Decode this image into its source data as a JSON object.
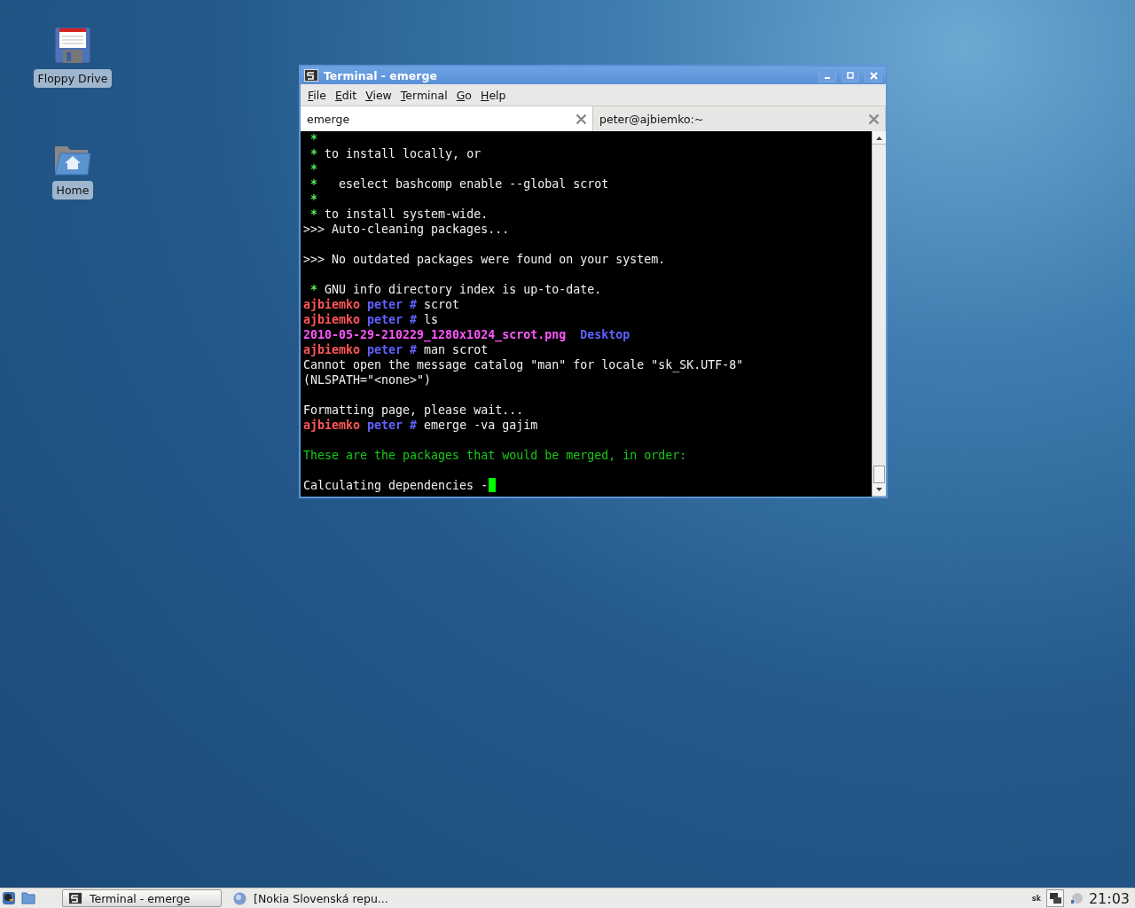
{
  "desktop_icons": [
    {
      "kind": "floppy",
      "label": "Floppy Drive"
    },
    {
      "kind": "home",
      "label": "Home"
    }
  ],
  "window": {
    "title": "Terminal - emerge",
    "active": true
  },
  "menu": [
    "File",
    "Edit",
    "View",
    "Terminal",
    "Go",
    "Help"
  ],
  "tabs": [
    {
      "label": "emerge",
      "selected": true
    },
    {
      "label": "peter@ajbiemko:~",
      "selected": false
    }
  ],
  "terminal": {
    "lines": [
      {
        "kind": "text",
        "segments": [
          {
            "kind": "star",
            "text": " *"
          }
        ]
      },
      {
        "kind": "text",
        "segments": [
          {
            "kind": "star",
            "text": " *"
          },
          {
            "kind": "plain",
            "text": " to install locally, or"
          }
        ]
      },
      {
        "kind": "text",
        "segments": [
          {
            "kind": "star",
            "text": " *"
          }
        ]
      },
      {
        "kind": "text",
        "segments": [
          {
            "kind": "star",
            "text": " *"
          },
          {
            "kind": "plain",
            "text": "   eselect bashcomp enable --global scrot"
          }
        ]
      },
      {
        "kind": "text",
        "segments": [
          {
            "kind": "star",
            "text": " *"
          }
        ]
      },
      {
        "kind": "text",
        "segments": [
          {
            "kind": "star",
            "text": " *"
          },
          {
            "kind": "plain",
            "text": " to install system-wide."
          }
        ]
      },
      {
        "kind": "text",
        "segments": [
          {
            "kind": "plain",
            "text": ">>> Auto-cleaning packages..."
          }
        ]
      },
      {
        "kind": "blank"
      },
      {
        "kind": "text",
        "segments": [
          {
            "kind": "plain",
            "text": ">>> No outdated packages were found on your system."
          }
        ]
      },
      {
        "kind": "blank"
      },
      {
        "kind": "text",
        "segments": [
          {
            "kind": "star",
            "text": " *"
          },
          {
            "kind": "plain",
            "text": " GNU info directory index is up-to-date."
          }
        ]
      },
      {
        "kind": "text",
        "segments": [
          {
            "kind": "host",
            "text": "ajbiemko"
          },
          {
            "kind": "user",
            "text": " peter #"
          },
          {
            "kind": "plain",
            "text": " scrot"
          }
        ]
      },
      {
        "kind": "text",
        "segments": [
          {
            "kind": "host",
            "text": "ajbiemko"
          },
          {
            "kind": "user",
            "text": " peter #"
          },
          {
            "kind": "plain",
            "text": " ls"
          }
        ]
      },
      {
        "kind": "text",
        "segments": [
          {
            "kind": "file",
            "text": "2010-05-29-210229_1280x1024_scrot.png"
          },
          {
            "kind": "dir",
            "text": "  Desktop"
          }
        ]
      },
      {
        "kind": "text",
        "segments": [
          {
            "kind": "host",
            "text": "ajbiemko"
          },
          {
            "kind": "user",
            "text": " peter #"
          },
          {
            "kind": "plain",
            "text": " man scrot"
          }
        ]
      },
      {
        "kind": "text",
        "segments": [
          {
            "kind": "plain",
            "text": "Cannot open the message catalog \"man\" for locale \"sk_SK.UTF-8\""
          }
        ]
      },
      {
        "kind": "text",
        "segments": [
          {
            "kind": "plain",
            "text": "(NLSPATH=\"<none>\")"
          }
        ]
      },
      {
        "kind": "blank"
      },
      {
        "kind": "text",
        "segments": [
          {
            "kind": "plain",
            "text": "Formatting page, please wait..."
          }
        ]
      },
      {
        "kind": "text",
        "segments": [
          {
            "kind": "host",
            "text": "ajbiemko"
          },
          {
            "kind": "user",
            "text": " peter #"
          },
          {
            "kind": "plain",
            "text": " emerge -va gajim"
          }
        ]
      },
      {
        "kind": "blank"
      },
      {
        "kind": "text",
        "segments": [
          {
            "kind": "notice",
            "text": "These are the packages that would be merged, in order:"
          }
        ]
      },
      {
        "kind": "blank"
      },
      {
        "kind": "text",
        "segments": [
          {
            "kind": "plain",
            "text": "Calculating dependencies -"
          }
        ]
      }
    ],
    "cursor": true
  },
  "taskbar": {
    "tasks": [
      {
        "kind": "terminal",
        "label": "Terminal - emerge",
        "selected": true
      },
      {
        "kind": "globe",
        "label": "[Nokia Slovenská repu...",
        "selected": false
      }
    ],
    "keyboard_layout": "sk",
    "clock": "21:03"
  }
}
